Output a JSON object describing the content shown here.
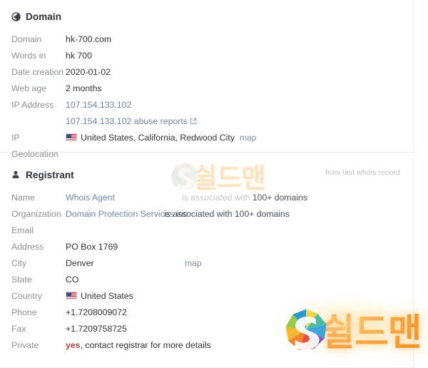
{
  "domain_section": {
    "icon": "globe-icon",
    "title": "Domain",
    "rows": [
      {
        "label": "Domain",
        "value": "hk-700.com",
        "type": "text"
      },
      {
        "label": "Words in",
        "value": "hk 700",
        "type": "text"
      },
      {
        "label": "Date creation",
        "value": "2020-01-02",
        "type": "text"
      },
      {
        "label": "Web age",
        "value": "2 months",
        "type": "text"
      },
      {
        "label": "IP Address",
        "value": "107.154.133.102",
        "type": "link"
      },
      {
        "label": "",
        "value": "107.154.133.102 abuse reports",
        "type": "link-external"
      },
      {
        "label": "IP Geolocation",
        "value": "United States, California, Redwood City",
        "type": "flag-text",
        "map_label": "map"
      }
    ]
  },
  "registrant_section": {
    "icon": "user-icon",
    "title": "Registrant",
    "note": "from last whois record",
    "rows": [
      {
        "label": "Name",
        "value": "Whois Agent",
        "type": "link",
        "assoc_prefix": "is associated with ",
        "assoc_strong": "100+ domains"
      },
      {
        "label": "Organization",
        "value": "Domain Protection Services inc",
        "type": "link",
        "assoc_prefix": "is associated with ",
        "assoc_strong": "100+ domains"
      },
      {
        "label": "Email",
        "value": "",
        "type": "text"
      },
      {
        "label": "Address",
        "value": "PO Box 1769",
        "type": "text"
      },
      {
        "label": "City",
        "value": "Denver",
        "type": "text",
        "map_label": "map"
      },
      {
        "label": "State",
        "value": "CO",
        "type": "text"
      },
      {
        "label": "Country",
        "value": "United States",
        "type": "flag-text"
      },
      {
        "label": "Phone",
        "value": "+1.7208009072",
        "type": "text"
      },
      {
        "label": "Fax",
        "value": "+1.7209758725",
        "type": "text"
      },
      {
        "label": "Private",
        "value": "yes",
        "type": "private",
        "value_suffix": ", contact registrar for more details"
      }
    ]
  },
  "watermark": {
    "text": "쉴드맨",
    "logo": "shieldman-s-logo"
  },
  "colors": {
    "link": "#6f86a3",
    "label": "#8d9194",
    "value": "#2f3336",
    "note": "#b9bcc0",
    "private_yes": "#a8473f",
    "watermark_orange": "#f5901e",
    "card_border": "#eceef0"
  }
}
